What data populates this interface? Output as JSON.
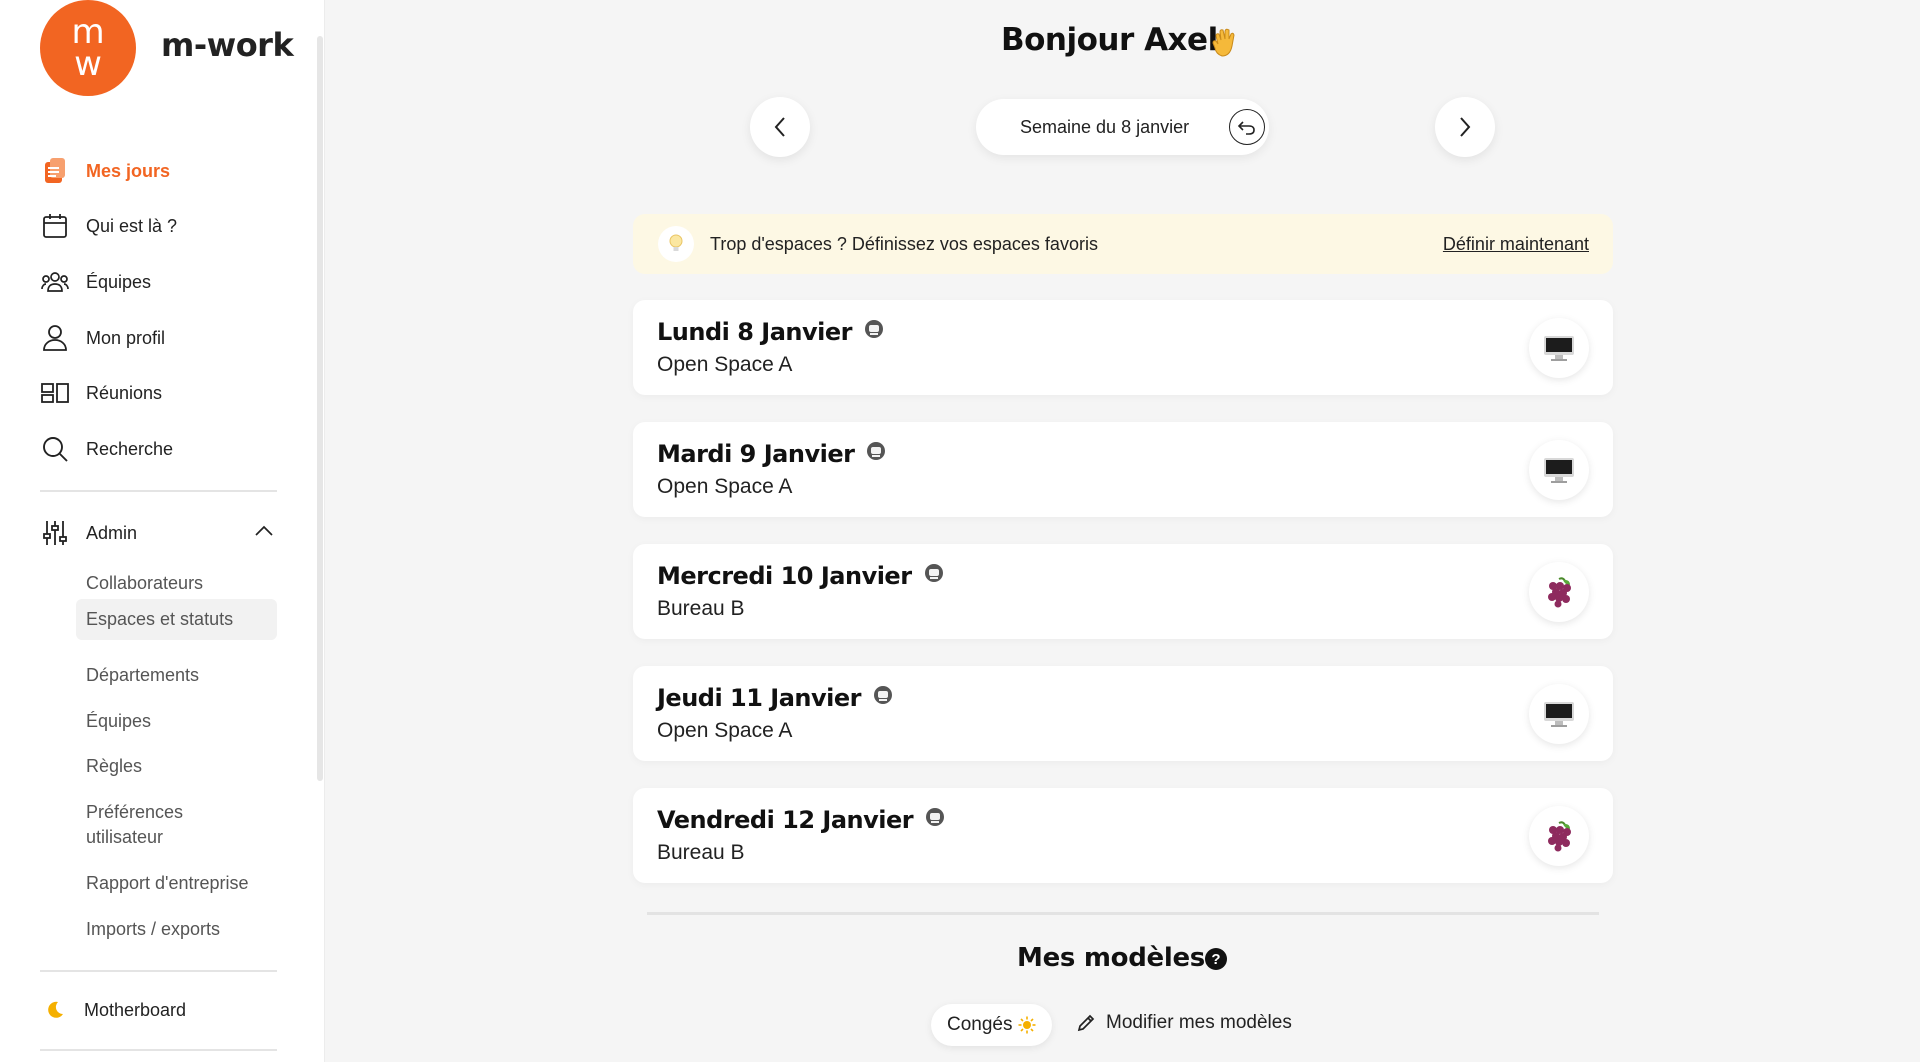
{
  "brand": {
    "logo_top": "m",
    "logo_bottom": "w",
    "name": "m-work",
    "color": "#f26522"
  },
  "nav": {
    "items": [
      {
        "label": "Mes jours",
        "icon": "clipboard-icon",
        "active": true
      },
      {
        "label": "Qui est là ?",
        "icon": "calendar-icon"
      },
      {
        "label": "Équipes",
        "icon": "team-icon"
      },
      {
        "label": "Mon profil",
        "icon": "user-icon"
      },
      {
        "label": "Réunions",
        "icon": "rooms-icon"
      },
      {
        "label": "Recherche",
        "icon": "search-icon"
      }
    ],
    "admin": {
      "label": "Admin",
      "items": [
        "Collaborateurs",
        "Espaces et statuts",
        "Départements",
        "Équipes",
        "Règles",
        "Préférences utilisateur",
        "Rapport d'entreprise",
        "Imports / exports"
      ],
      "selected": "Espaces et statuts"
    },
    "footer_item": {
      "label": "Motherboard",
      "icon": "moon-icon"
    }
  },
  "header": {
    "greeting": "Bonjour Axel",
    "greeting_emoji": "waving-hand-icon",
    "week_label": "Semaine du 8 janvier"
  },
  "tip": {
    "text": "Trop d'espaces ? Définissez vos espaces favoris",
    "link": "Définir maintenant"
  },
  "days": [
    {
      "title": "Lundi 8 Janvier",
      "place": "Open Space A",
      "spot_icon": "desktop-computer-icon"
    },
    {
      "title": "Mardi 9 Janvier",
      "place": "Open Space A",
      "spot_icon": "desktop-computer-icon"
    },
    {
      "title": "Mercredi 10 Janvier",
      "place": "Bureau B",
      "spot_icon": "grapes-icon"
    },
    {
      "title": "Jeudi 11 Janvier",
      "place": "Open Space A",
      "spot_icon": "desktop-computer-icon"
    },
    {
      "title": "Vendredi 12 Janvier",
      "place": "Bureau B",
      "spot_icon": "grapes-icon"
    }
  ],
  "models": {
    "title": "Mes modèles",
    "help": "?",
    "chip": "Congés",
    "edit": "Modifier mes modèles"
  }
}
